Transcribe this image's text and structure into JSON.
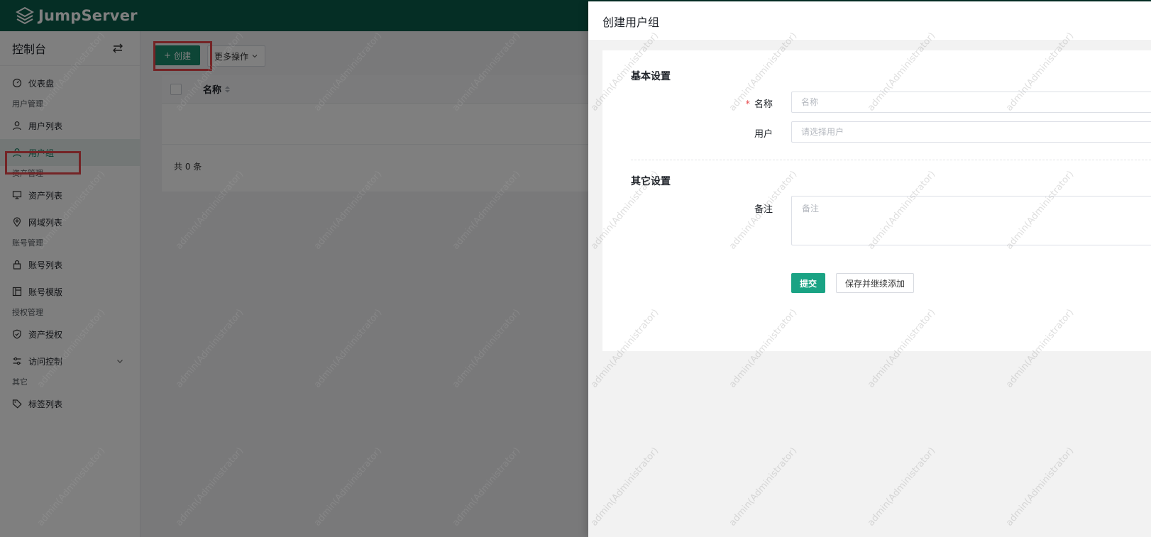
{
  "app": {
    "brand": "JumpServer",
    "brand_color": "#0b5d4b",
    "accent": "#1a8a6c"
  },
  "sidebar": {
    "title": "控制台",
    "switch_icon": "switch-arrows-icon",
    "dashboard": {
      "label": "仪表盘",
      "icon": "dashboard-icon"
    },
    "sections": {
      "user_mgmt": "用户管理",
      "asset_mgmt": "资产管理",
      "account_mgmt": "账号管理",
      "perm_mgmt": "授权管理",
      "other": "其它"
    },
    "items": {
      "user_list": "用户列表",
      "user_group": "用户组",
      "asset_list": "资产列表",
      "domain_list": "网域列表",
      "account_list": "账号列表",
      "account_template": "账号模版",
      "asset_perm": "资产授权",
      "access_control": "访问控制",
      "tag_list": "标签列表"
    },
    "active_item": "用户组"
  },
  "main": {
    "create_button": "创建",
    "more_actions": "更多操作",
    "table": {
      "columns": [
        "名称"
      ],
      "rows": []
    },
    "total": "共 0 条"
  },
  "drawer": {
    "title": "创建用户组",
    "basic_section": "基本设置",
    "name_label": "名称",
    "name_placeholder": "名称",
    "users_label": "用户",
    "users_placeholder": "请选择用户",
    "other_section": "其它设置",
    "comment_label": "备注",
    "comment_placeholder": "备注",
    "submit": "提交",
    "save_continue": "保存并继续添加"
  },
  "watermark": "admin(Administrator)"
}
